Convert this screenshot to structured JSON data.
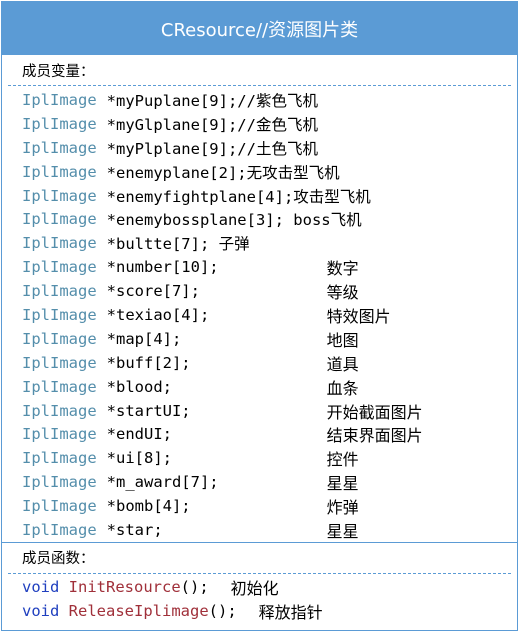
{
  "title": "CResource//资源图片类",
  "attributes_heading": "成员变量：",
  "methods_heading": "成员函数：",
  "attributes": [
    {
      "type": "IplImage",
      "decl": "*myPuplane[9];//紫色飞机",
      "comment": ""
    },
    {
      "type": "IplImage",
      "decl": "*myGlplane[9];//金色飞机",
      "comment": ""
    },
    {
      "type": "IplImage",
      "decl": "*myPlplane[9];//土色飞机",
      "comment": ""
    },
    {
      "type": "IplImage",
      "decl": "*enemyplane[2];无攻击型飞机",
      "comment": ""
    },
    {
      "type": "IplImage",
      "decl": "*enemyfightplane[4];攻击型飞机",
      "comment": ""
    },
    {
      "type": "IplImage",
      "decl": "*enemybossplane[3]; boss飞机",
      "comment": ""
    },
    {
      "type": "IplImage",
      "decl": "*bultte[7]; 子弹",
      "comment": ""
    },
    {
      "type": "IplImage",
      "decl": "*number[10];",
      "comment": "数字"
    },
    {
      "type": "IplImage",
      "decl": "*score[7];",
      "comment": "等级"
    },
    {
      "type": "IplImage",
      "decl": "*texiao[4];",
      "comment": "特效图片"
    },
    {
      "type": "IplImage",
      "decl": "*map[4];",
      "comment": "地图"
    },
    {
      "type": "IplImage",
      "decl": "*buff[2];",
      "comment": "道具"
    },
    {
      "type": "IplImage",
      "decl": "*blood;",
      "comment": "血条"
    },
    {
      "type": "IplImage",
      "decl": "*startUI;",
      "comment": "开始截面图片"
    },
    {
      "type": "IplImage",
      "decl": "*endUI;",
      "comment": "结束界面图片"
    },
    {
      "type": "IplImage",
      "decl": "*ui[8];",
      "comment": "控件"
    },
    {
      "type": "IplImage",
      "decl": "*m_award[7];",
      "comment": "星星"
    },
    {
      "type": "IplImage",
      "decl": "*bomb[4];",
      "comment": "炸弹"
    },
    {
      "type": "IplImage",
      "decl": "*star;",
      "comment": "星星"
    }
  ],
  "methods": [
    {
      "type": "void",
      "name": "InitResource",
      "paren": "();",
      "comment": "初始化"
    },
    {
      "type": "void",
      "name": "ReleaseIplimage",
      "paren": "();",
      "comment": "释放指针"
    }
  ],
  "colors": {
    "header_bg": "#5b9bd5",
    "type_color": "#548eab",
    "method_type_color": "#1f3fbf",
    "method_name_color": "#a0303a"
  }
}
